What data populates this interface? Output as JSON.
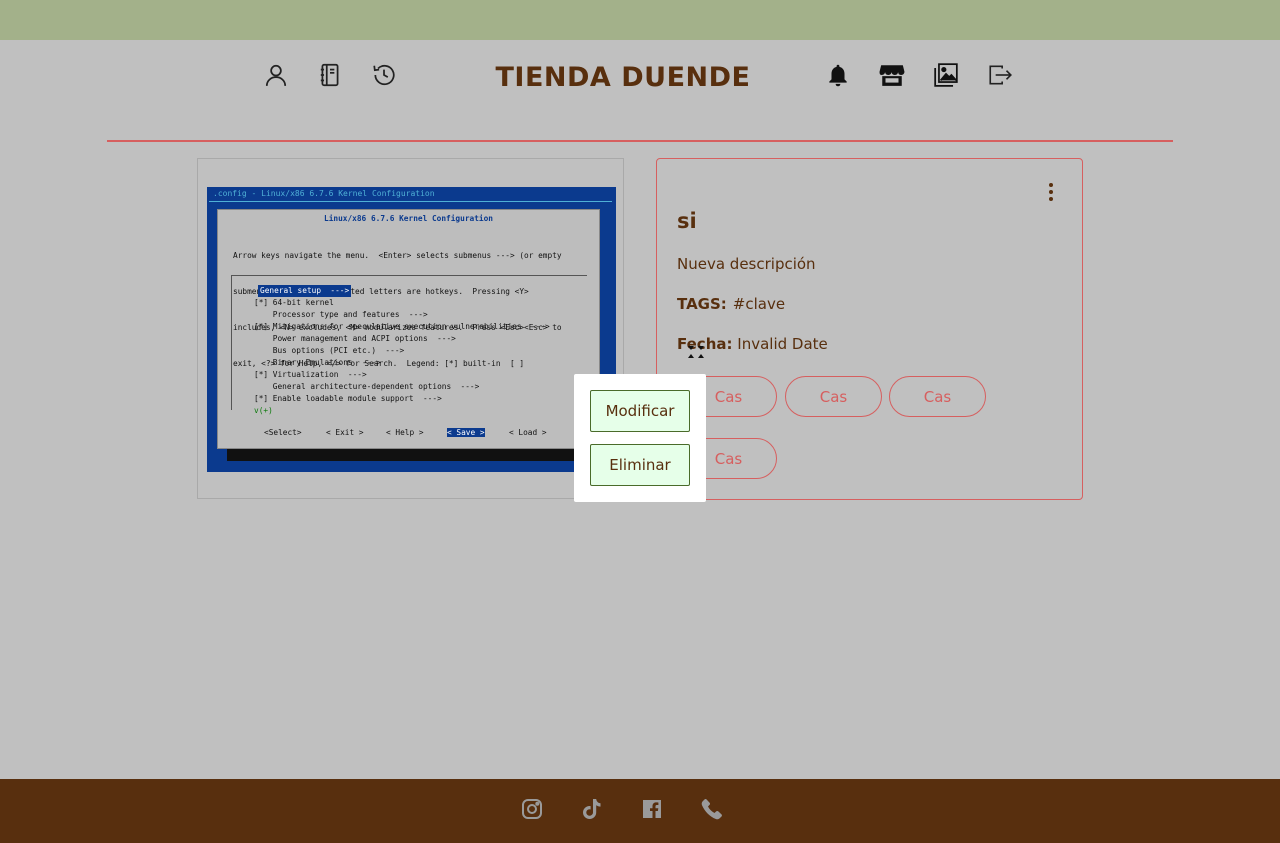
{
  "brand": {
    "title": "TIENDA DUENDE"
  },
  "nav": {
    "left_icons": [
      "user-icon",
      "journal-icon",
      "history-icon"
    ],
    "right_icons": [
      "bell-icon",
      "store-icon",
      "images-icon",
      "logout-icon"
    ]
  },
  "colors": {
    "topbar": "#a3b18a",
    "brown": "#582f0e",
    "accent_red": "#d65f5f",
    "background": "#c0c0c0",
    "popup_button": "#e6ffe9"
  },
  "product_image": {
    "window_title": ".config - Linux/x86 6.7.6 Kernel Configuration",
    "dialog_title": "Linux/x86 6.7.6 Kernel Configuration",
    "help_lines": [
      "Arrow keys navigate the menu.  <Enter> selects submenus ---> (or empty",
      "submenus ----).  Highlighted letters are hotkeys.  Pressing <Y>",
      "includes, <N> excludes, <M> modularizes features.  Press <Esc><Esc> to",
      "exit, <?> for Help, </> for Search.  Legend: [*] built-in  [ ]"
    ],
    "menu_items": [
      "General setup  --->",
      "[*] 64-bit kernel",
      "    Processor type and features  --->",
      "[*] Mitigations for speculative execution vulnerabilities  --->",
      "    Power management and ACPI options  --->",
      "    Bus options (PCI etc.)  --->",
      "    Binary Emulations  --->",
      "[*] Virtualization  --->",
      "    General architecture-dependent options  --->",
      "[*] Enable loadable module support  --->",
      "v(+)"
    ],
    "buttons": [
      "<Select>",
      "< Exit >",
      "< Help >",
      "< Save >",
      "< Load >"
    ]
  },
  "card": {
    "title": "si",
    "description": "Nueva descripción",
    "tags_label": "TAGS:",
    "tags_value": "#clave",
    "date_label": "Fecha:",
    "date_value": "Invalid Date",
    "chips": [
      "Cas",
      "Cas",
      "Cas",
      "Cas"
    ]
  },
  "popup": {
    "modify_label": "Modificar",
    "delete_label": "Eliminar"
  },
  "footer": {
    "icons": [
      "instagram-icon",
      "tiktok-icon",
      "facebook-icon",
      "phone-icon"
    ]
  }
}
